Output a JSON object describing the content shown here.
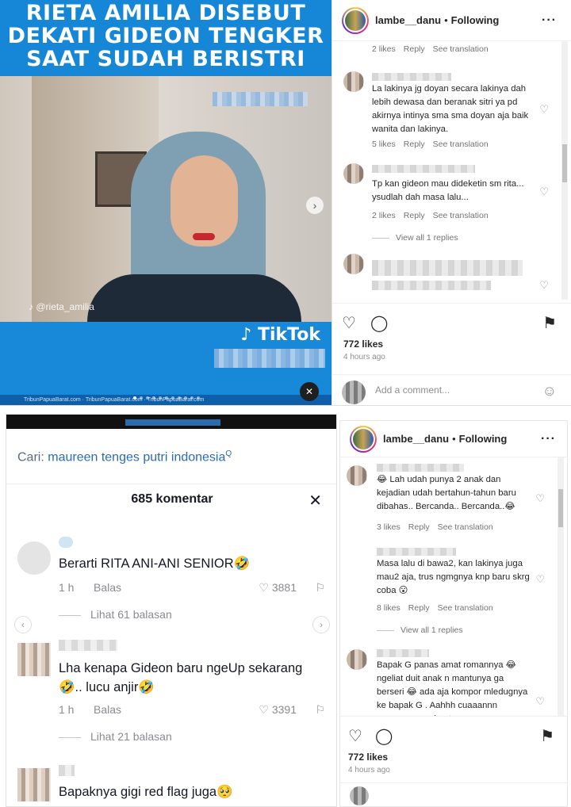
{
  "top": {
    "headline": [
      "RIETA AMILIA DISEBUT",
      "DEKATI GIDEON TENGKER",
      "SAAT SUDAH BERISTRI"
    ],
    "watermark": "@rieta_amilia",
    "brand": "TikTok",
    "footer_credit": "TribunPapuaBarat.com",
    "instagram": {
      "username": "lambe__danu",
      "follow_status": "Following",
      "comments": [
        {
          "text": "",
          "likes": "2 likes",
          "reply": "Reply",
          "translate": "See translation"
        },
        {
          "text": "La lakinya jg doyan secara lakinya dah lebih dewasa dan beranak sitri ya pd akirnya intinya sma sma doyan aja baik wanita dan lakinya.",
          "likes": "5 likes",
          "reply": "Reply",
          "translate": "See translation"
        },
        {
          "text": "Tp kan gideon mau dideketin sm rita... ysudlah dah masa lalu...",
          "likes": "2 likes",
          "reply": "Reply",
          "translate": "See translation"
        }
      ],
      "view_replies": "View all 1 replies",
      "like_total": "772 likes",
      "time_ago": "4 hours ago",
      "add_comment_placeholder": "Add a comment..."
    }
  },
  "bottom": {
    "search_label": "Cari:",
    "search_query": "maureen tenges putri indonesia",
    "comment_count": "685 komentar",
    "comments": [
      {
        "text": "Berarti RITA ANI-ANI SENIOR🤣",
        "time": "1 h",
        "reply": "Balas",
        "likes": "3881",
        "view_replies": "Lihat 61 balasan"
      },
      {
        "text": "Lha kenapa Gideon baru ngeUp sekarang 🤣.. lucu anjir🤣",
        "time": "1 h",
        "reply": "Balas",
        "likes": "3391",
        "view_replies": "Lihat 21 balasan"
      },
      {
        "text": "Bapaknya gigi red flag juga🥺"
      }
    ],
    "instagram": {
      "username": "lambe__danu",
      "follow_status": "Following",
      "comments": [
        {
          "text": "😂 Lah udah punya 2 anak dan kejadian udah bertahun-tahun baru dibahas.. Bercanda.. Bercanda..😂",
          "likes": "3 likes",
          "reply": "Reply",
          "translate": "See translation"
        },
        {
          "text": "Masa lalu di bawa2, kan lakinya juga mau2 aja, trus ngmgnya knp baru skrg coba 😮",
          "likes": "8 likes",
          "reply": "Reply",
          "translate": "See translation"
        },
        {
          "text": "Bapak G panas amat romannya 😂 ngeliat duit anak n mantunya ga berseri 😂 ada aja kompor mledugnya ke bapak G . Aahhh cuaaannn memang membuat orang"
        }
      ],
      "view_replies": "View all 1 replies",
      "like_total": "772 likes",
      "time_ago": "4 hours ago"
    }
  },
  "colors": {
    "tribun_blue": "#1587d6",
    "tiktok_link": "#2b6cb0",
    "ig_text": "#262626",
    "ig_meta": "#737373"
  }
}
